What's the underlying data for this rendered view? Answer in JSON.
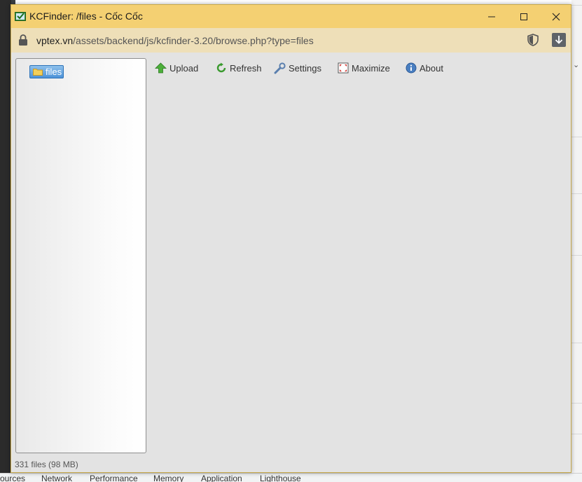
{
  "window": {
    "title": "KCFinder: /files - Cốc Cốc",
    "controls": [
      "minimize",
      "maximize",
      "close"
    ]
  },
  "address_bar": {
    "host": "vptex.vn",
    "path": "/assets/backend/js/kcfinder-3.20/browse.php?type=files"
  },
  "folder_tree": {
    "root": {
      "label": "files",
      "icon": "folder-icon",
      "selected": true
    }
  },
  "toolbar": {
    "upload": {
      "label": "Upload",
      "icon": "upload-arrow-icon"
    },
    "refresh": {
      "label": "Refresh",
      "icon": "refresh-icon"
    },
    "settings": {
      "label": "Settings",
      "icon": "wrench-icon"
    },
    "maximize": {
      "label": "Maximize",
      "icon": "maximize-icon"
    },
    "about": {
      "label": "About",
      "icon": "info-icon"
    }
  },
  "status": {
    "text": "331 files (98 MB)"
  },
  "devtools_tabs": [
    "ources",
    "Network",
    "Performance",
    "Memory",
    "Application",
    "Lighthouse"
  ],
  "colors": {
    "titlebar": "#f4d072",
    "addressbar": "#eedfb8",
    "selection": "#4d92d8",
    "panel": "#e3e3e3"
  }
}
